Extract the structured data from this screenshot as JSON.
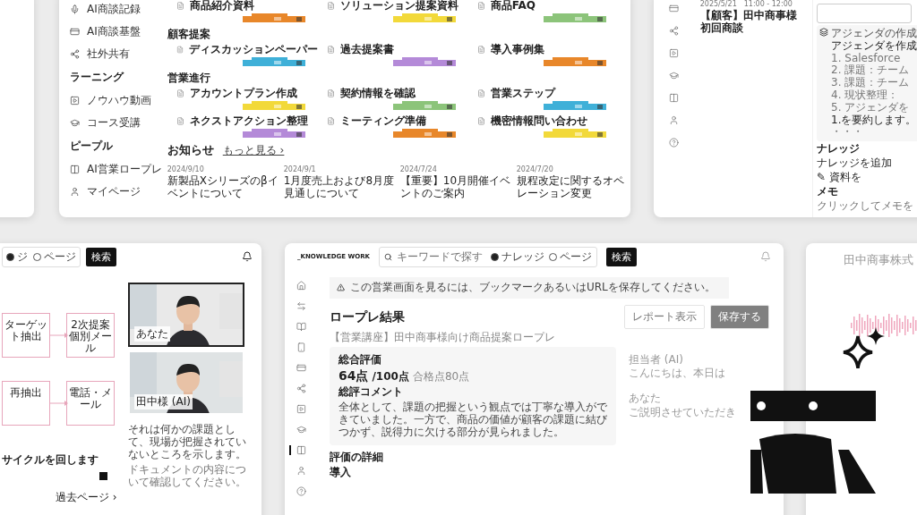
{
  "home_window": {
    "sidebar": [
      {
        "kind": "item",
        "label": "AI商談記録"
      },
      {
        "kind": "item",
        "label": "AI商談基盤"
      },
      {
        "kind": "item",
        "label": "社外共有"
      },
      {
        "kind": "heading",
        "label": "ラーニング"
      },
      {
        "kind": "item",
        "label": "ノウハウ動画"
      },
      {
        "kind": "item",
        "label": "コース受講"
      },
      {
        "kind": "heading",
        "label": "ピープル"
      },
      {
        "kind": "item",
        "label": "AI営業ロープレ"
      },
      {
        "kind": "item",
        "label": "マイページ"
      }
    ],
    "groups": [
      {
        "items": [
          {
            "label": "商品紹介資料",
            "color": "#e8872a"
          },
          {
            "label": "ソリューション提案資料",
            "color": "#f2d93a"
          },
          {
            "label": "商品FAQ",
            "color": "#8cc47a"
          }
        ]
      },
      {
        "heading": "顧客提案",
        "items": [
          {
            "label": "ディスカッションペーパー",
            "color": "#3fb0d8"
          },
          {
            "label": "過去提案書",
            "color": "#b48ad8"
          },
          {
            "label": "導入事例集",
            "color": "#e8872a"
          }
        ]
      },
      {
        "heading": "営業進行",
        "items": [
          {
            "label": "アカウントプラン作成",
            "color": "#f2d93a"
          },
          {
            "label": "契約情報を確認",
            "color": "#8cc47a"
          },
          {
            "label": "営業ステップ",
            "color": "#3fb0d8"
          },
          {
            "label": "ネクストアクション整理",
            "color": "#b48ad8"
          },
          {
            "label": "ミーティング準備",
            "color": "#e8872a"
          },
          {
            "label": "機密情報問い合わせ",
            "color": "#f2d93a"
          }
        ]
      }
    ],
    "news": {
      "title": "お知らせ",
      "more": "もっと見る ›",
      "items": [
        {
          "date": "2024/9/10",
          "title": "新製品Xシリーズのβイベントについて"
        },
        {
          "date": "2024/9/1",
          "title": "1月度売上および8月度見通しについて"
        },
        {
          "date": "2024/7/24",
          "title": "【重要】10月開催イベントのご案内"
        },
        {
          "date": "2024/7/20",
          "title": "規程改定に関するオペレーション変更"
        }
      ]
    }
  },
  "meeting_window": {
    "date": "2025/5/21　11:00 - 12:00",
    "title": "【顧客】田中商事様初回商談",
    "assistant": {
      "heading": "アジェンダの作成",
      "subheading": "アジェンダを作成",
      "list": [
        "1. Salesforce",
        "2. 課題：チーム",
        "3. 課題：チーム",
        "4. 現状整理：",
        "5. アジェンダを"
      ],
      "summary": "1.を要約します。",
      "ellipsis": "・・・"
    },
    "knowledge": {
      "heading": "ナレッジ",
      "actions": [
        "ナレッジを追加",
        "✎ 資料を"
      ]
    },
    "memo": {
      "heading": "メモ",
      "placeholder": "クリックしてメモを"
    }
  },
  "roleplay_window": {
    "search_options": [
      {
        "label": "ジ",
        "selected": true
      },
      {
        "label": "ページ",
        "selected": false
      }
    ],
    "search_button": "検索",
    "flow_nodes": [
      {
        "label": "ターゲット抽出"
      },
      {
        "label": "2次提案個別メール"
      },
      {
        "label": "再抽出"
      },
      {
        "label": "電話・メール"
      }
    ],
    "heading": "サイクルを回します",
    "videos": [
      {
        "label": "あなた",
        "selected": true
      },
      {
        "label": "田中様 (AI)",
        "selected": false
      }
    ],
    "description": "それは何かの課題として、現場が把握されていないところを示します。",
    "link": "過去ページ ›",
    "note": "ドキュメントの内容について確認してください。"
  },
  "result_window": {
    "logo": "_KNOWLEDGE WORK",
    "search_placeholder": "キーワードで探す",
    "search_options": [
      {
        "label": "ナレッジ",
        "selected": true
      },
      {
        "label": "ページ",
        "selected": false
      }
    ],
    "search_button": "検索",
    "rail": [
      {
        "selected": false
      },
      {
        "selected": false
      },
      {
        "selected": false
      },
      {
        "selected": false
      },
      {
        "selected": false
      },
      {
        "selected": false
      },
      {
        "selected": false
      },
      {
        "selected": false
      },
      {
        "selected": true
      },
      {
        "selected": false
      },
      {
        "selected": false
      }
    ],
    "alert": "この営業画面を見るには、ブックマークあるいはURLを保存してください。",
    "title": "ロープレ結果",
    "breadcrumb": "【営業講座】田中商事様向け商品提案ロープレ",
    "actions": [
      "レポート表示",
      "保存する"
    ],
    "score": {
      "heading": "総合評価",
      "value": "64点",
      "total": "/100点",
      "pass": "合格点80点",
      "comment_heading": "総評コメント",
      "comment": "全体として、課題の把握という観点では丁寧な導入ができていました。一方で、商品の価値が顧客の課題に結びつかず、説得力に欠ける部分が見られました。"
    },
    "details_heading": "評価の詳細",
    "details_item": "導入",
    "transcript": [
      {
        "speaker": "担当者 (AI)",
        "text": "こんにちは、本日は"
      },
      {
        "speaker": "あなた",
        "text": "ご説明させていただき"
      }
    ]
  },
  "account_window": {
    "title": "田中商事株式"
  }
}
